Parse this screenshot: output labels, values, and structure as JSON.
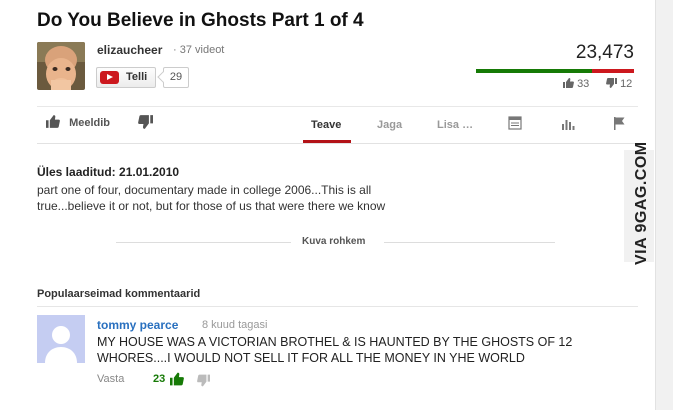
{
  "video": {
    "title": "Do You Believe in Ghosts Part 1 of 4",
    "views": "23,473",
    "likes": "33",
    "dislikes": "12",
    "like_ratio": 0.733,
    "colors": {
      "like_bar": "#167a06",
      "dislike_bar": "#cc181e",
      "active_tab": "#b31217",
      "link": "#2970bf"
    }
  },
  "channel": {
    "name": "elizaucheer",
    "videos": "· 37 videot",
    "subscribe_label": "Telli",
    "subscribers": "29"
  },
  "actions": {
    "like_label": "Meeldib",
    "tabs": [
      "Teave",
      "Jaga",
      "Lisa …"
    ],
    "icons": [
      "transcript-icon",
      "stats-icon",
      "flag-icon"
    ]
  },
  "description": {
    "upload_date": "Üles laaditud: 21.01.2010",
    "text": "part one of four, documentary made in college 2006...This is all true...believe it or not, but for those of us that were there we know",
    "show_more": "Kuva rohkem"
  },
  "watermark": "VIA 9GAG.COM",
  "comments": {
    "heading": "Populaarseimad kommentaarid",
    "items": [
      {
        "author": "tommy pearce",
        "time": "8 kuud tagasi",
        "text": "MY HOUSE WAS A VICTORIAN BROTHEL & IS HAUNTED BY THE GHOSTS OF 12 WHORES....I WOULD NOT SELL IT FOR ALL THE MONEY IN YHE WORLD",
        "reply_label": "Vasta",
        "likes": "23"
      }
    ]
  }
}
